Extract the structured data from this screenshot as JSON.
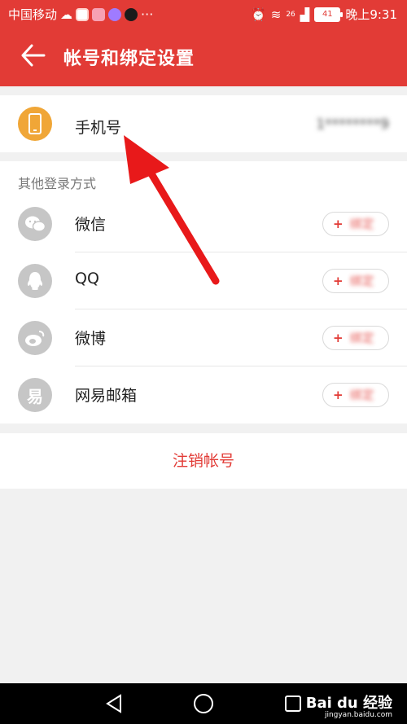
{
  "status_bar": {
    "carrier": "中国移动",
    "dots": "···",
    "signal_badge": "26",
    "battery": "41",
    "time": "晚上9:31"
  },
  "header": {
    "title": "帐号和绑定设置"
  },
  "phone": {
    "label": "手机号",
    "value": "1********9"
  },
  "other_login": {
    "section_title": "其他登录方式",
    "items": [
      {
        "label": "微信",
        "icon": "wechat-icon",
        "icon_color": "#c6c6c6",
        "button_plus": "+",
        "button_text": "绑定"
      },
      {
        "label": "QQ",
        "icon": "qq-icon",
        "icon_color": "#c6c6c6",
        "button_plus": "+",
        "button_text": "绑定"
      },
      {
        "label": "微博",
        "icon": "weibo-icon",
        "icon_color": "#c6c6c6",
        "button_plus": "+",
        "button_text": "绑定"
      },
      {
        "label": "网易邮箱",
        "icon": "netease-mail-icon",
        "icon_color": "#c6c6c6",
        "button_plus": "+",
        "button_text": "绑定"
      }
    ]
  },
  "logout": {
    "label": "注销帐号"
  },
  "watermark": {
    "brand": "Bai du 经验",
    "url": "jingyan.baidu.com"
  },
  "colors": {
    "accent": "#e23b36",
    "phone_icon_bg": "#f0a637"
  }
}
